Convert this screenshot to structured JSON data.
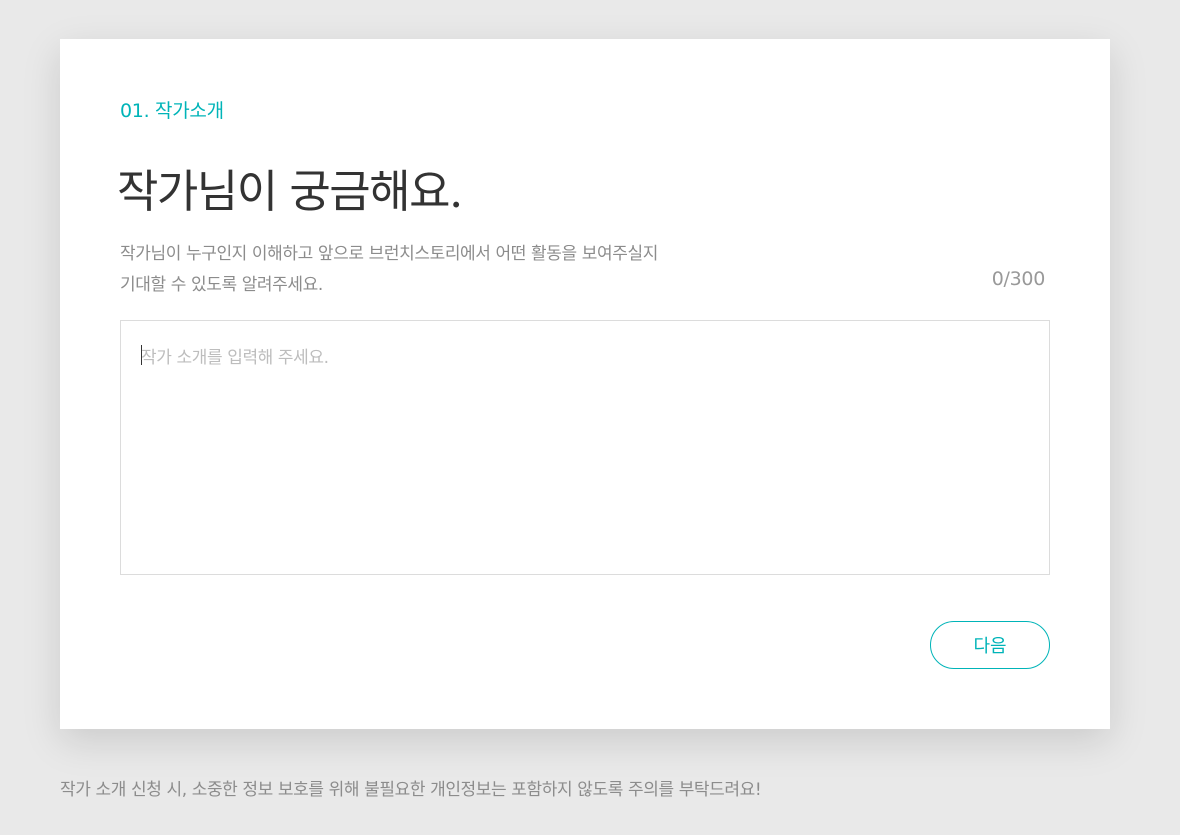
{
  "card": {
    "step_label": "01. 작가소개",
    "title": "작가님이 궁금해요.",
    "description_line1": "작가님이 누구인지 이해하고 앞으로 브런치스토리에서 어떤 활동을 보여주실지",
    "description_line2": "기대할 수 있도록 알려주세요.",
    "char_counter": "0/300",
    "intro_input": {
      "value": "",
      "placeholder": "작가 소개를 입력해 주세요."
    },
    "next_button_label": "다음"
  },
  "footer": {
    "notice": "작가 소개 신청 시, 소중한 정보 보호를 위해 불필요한 개인정보는 포함하지 않도록 주의를 부탁드려요!"
  },
  "colors": {
    "accent": "#00b4b8",
    "background": "#e9e9e9",
    "card": "#ffffff",
    "title_text": "#333333",
    "muted_text": "#8c8c8c"
  }
}
